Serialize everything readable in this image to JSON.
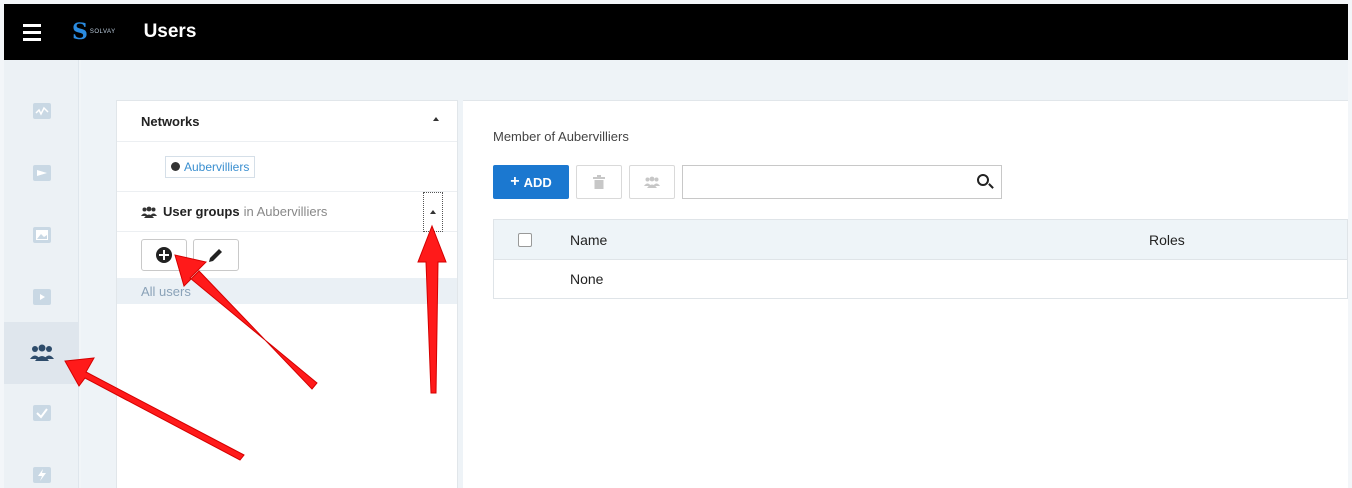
{
  "app": {
    "brand": "SOLVAY",
    "title": "Users"
  },
  "sidebar": {
    "items": [
      {
        "name": "activity-icon",
        "active": false
      },
      {
        "name": "message-icon",
        "active": false
      },
      {
        "name": "image-icon",
        "active": false
      },
      {
        "name": "media-icon",
        "active": false
      },
      {
        "name": "users-icon",
        "active": true
      },
      {
        "name": "check-icon",
        "active": false
      },
      {
        "name": "bolt-icon",
        "active": false
      }
    ]
  },
  "left_panel": {
    "networks_label": "Networks",
    "network_name": "Aubervilliers",
    "user_groups_label": "User groups",
    "user_groups_in": "in Aubervilliers",
    "all_users_label": "All users"
  },
  "right_panel": {
    "member_title": "Member of Aubervilliers",
    "add_label": "ADD",
    "search_placeholder": "",
    "columns": [
      "Name",
      "Roles"
    ],
    "rows": [
      {
        "name": "None"
      }
    ]
  },
  "colors": {
    "topbar": "#000000",
    "accent": "#1b78d0",
    "annotation_arrow": "#ff1a1a"
  }
}
